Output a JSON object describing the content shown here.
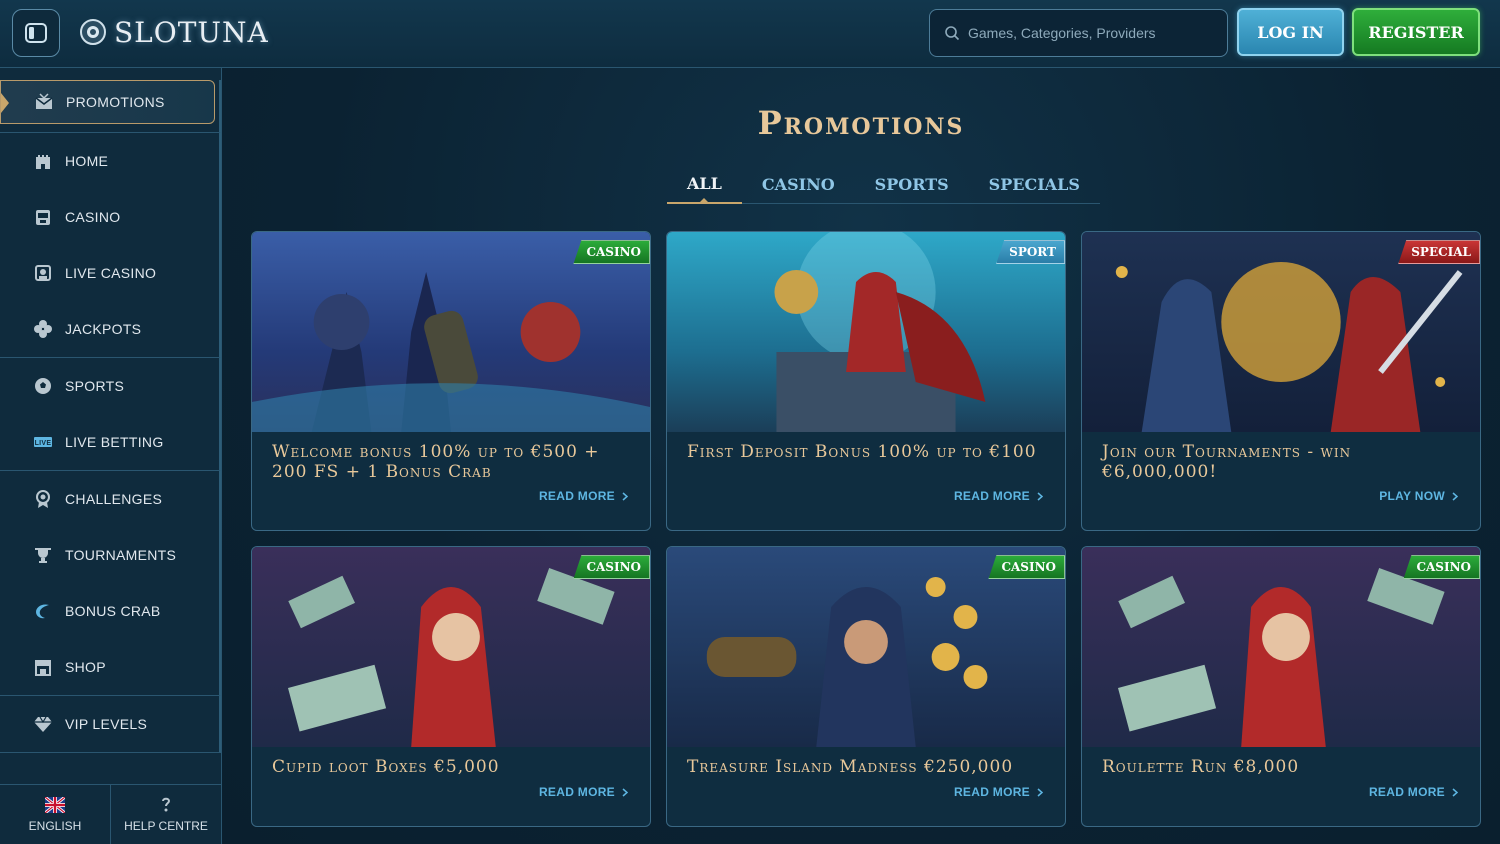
{
  "header": {
    "logo_text": "SLOTUNA",
    "search_placeholder": "Games, Categories, Providers",
    "login_label": "LOG IN",
    "register_label": "REGISTER"
  },
  "sidebar": {
    "groups": [
      [
        {
          "label": "PROMOTIONS",
          "icon": "gift-icon",
          "active": true
        }
      ],
      [
        {
          "label": "HOME",
          "icon": "castle-icon"
        },
        {
          "label": "CASINO",
          "icon": "slot-machine-icon"
        },
        {
          "label": "LIVE CASINO",
          "icon": "live-dealer-icon"
        },
        {
          "label": "JACKPOTS",
          "icon": "clover-icon"
        }
      ],
      [
        {
          "label": "SPORTS",
          "icon": "soccer-ball-icon"
        },
        {
          "label": "LIVE BETTING",
          "icon": "live-badge-icon"
        }
      ],
      [
        {
          "label": "CHALLENGES",
          "icon": "medal-icon"
        },
        {
          "label": "TOURNAMENTS",
          "icon": "trophy-icon"
        },
        {
          "label": "BONUS CRAB",
          "icon": "crab-icon"
        },
        {
          "label": "SHOP",
          "icon": "shop-icon"
        }
      ],
      [
        {
          "label": "VIP LEVELS",
          "icon": "diamond-icon"
        }
      ]
    ],
    "language_label": "ENGLISH",
    "help_label": "HELP CENTRE"
  },
  "main": {
    "title": "Promotions",
    "tabs": [
      {
        "label": "ALL",
        "active": true
      },
      {
        "label": "CASINO"
      },
      {
        "label": "SPORTS"
      },
      {
        "label": "SPECIALS"
      }
    ],
    "cards": [
      {
        "badge": "CASINO",
        "title": "Welcome bonus 100% up to €500 + 200 FS + 1 Bonus Crab",
        "link": "READ MORE"
      },
      {
        "badge": "SPORT",
        "title": "First Deposit Bonus 100% up to €100",
        "link": "READ MORE"
      },
      {
        "badge": "SPECIAL",
        "title": "Join our Tournaments - win €6,000,000!",
        "link": "PLAY NOW"
      },
      {
        "badge": "CASINO",
        "title": "Cupid loot Boxes €5,000",
        "link": "READ MORE"
      },
      {
        "badge": "CASINO",
        "title": "Treasure Island Madness €250,000",
        "link": "READ MORE"
      },
      {
        "badge": "CASINO",
        "title": "Roulette Run €8,000",
        "link": "READ MORE"
      }
    ]
  },
  "colors": {
    "accent_gold": "#e8c89a",
    "link_blue": "#5eb6e2",
    "badge_casino": "#2cab3a",
    "badge_sport": "#4aa6cf",
    "badge_special": "#c93636"
  }
}
